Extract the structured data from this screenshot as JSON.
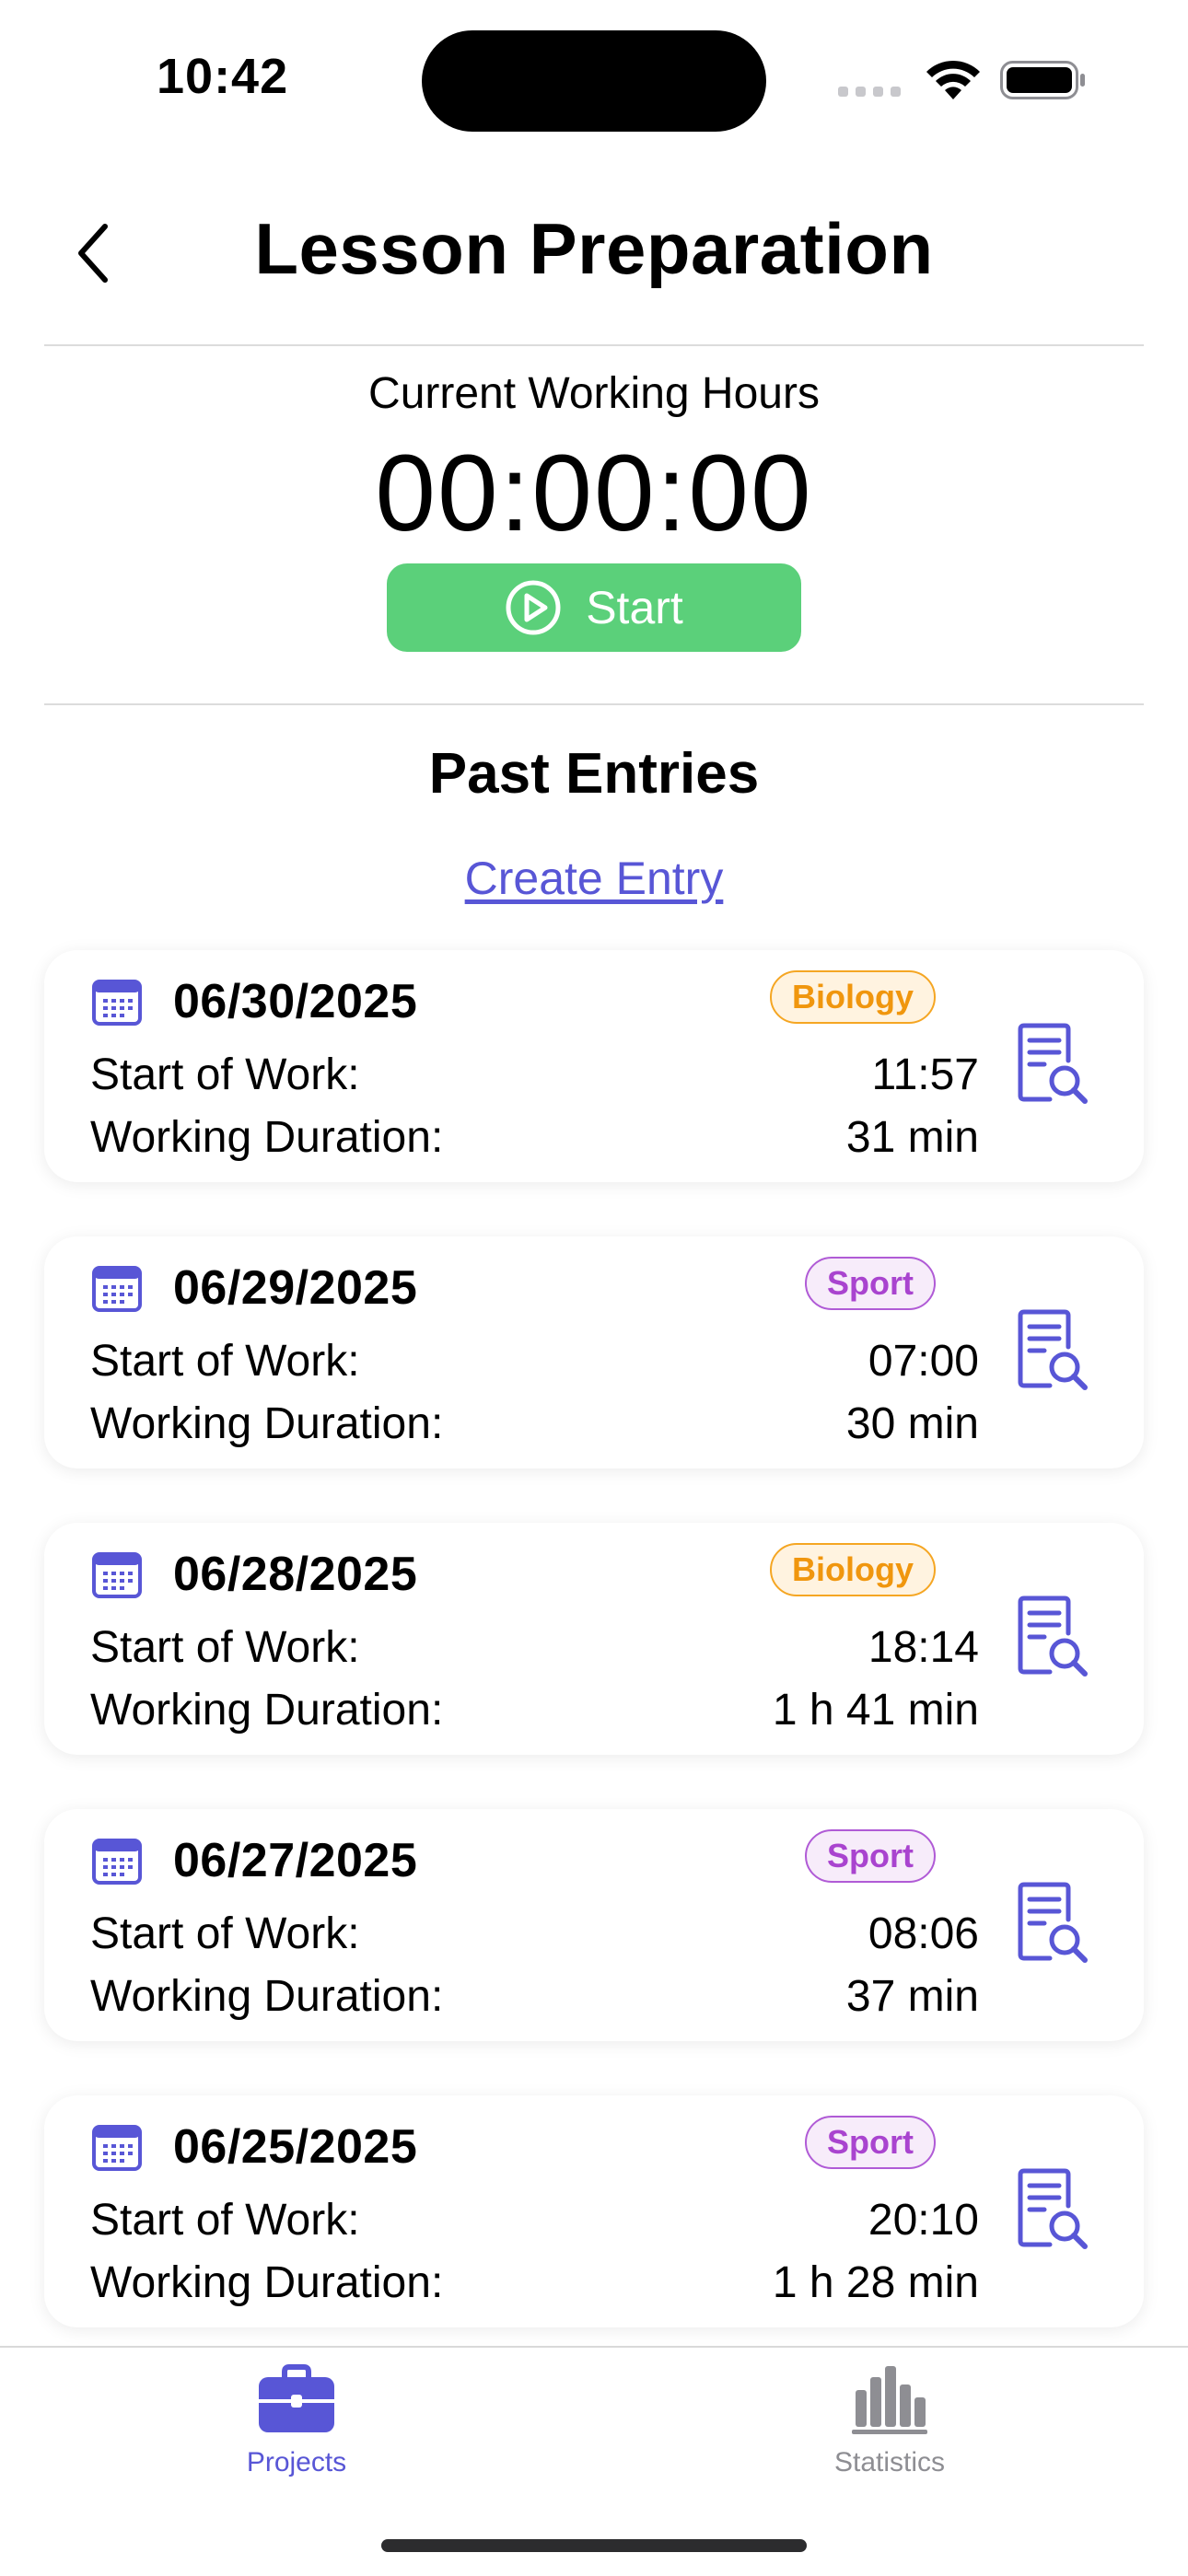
{
  "status_bar": {
    "time": "10:42"
  },
  "header": {
    "title": "Lesson Preparation"
  },
  "timer": {
    "label": "Current Working Hours",
    "value": "00:00:00",
    "start_label": "Start"
  },
  "past_entries": {
    "title": "Past Entries",
    "create_label": "Create Entry",
    "start_label": "Start of Work:",
    "duration_label": "Working Duration:",
    "items": [
      {
        "date": "06/30/2025",
        "tag": "Biology",
        "start": "11:57",
        "duration": "31 min"
      },
      {
        "date": "06/29/2025",
        "tag": "Sport",
        "start": "07:00",
        "duration": "30 min"
      },
      {
        "date": "06/28/2025",
        "tag": "Biology",
        "start": "18:14",
        "duration": "1 h 41 min"
      },
      {
        "date": "06/27/2025",
        "tag": "Sport",
        "start": "08:06",
        "duration": "37 min"
      },
      {
        "date": "06/25/2025",
        "tag": "Sport",
        "start": "20:10",
        "duration": "1 h 28 min"
      }
    ]
  },
  "tab_bar": {
    "tabs": [
      {
        "label": "Projects",
        "icon": "briefcase-icon",
        "active": true
      },
      {
        "label": "Statistics",
        "icon": "bar-chart-icon",
        "active": false
      }
    ]
  },
  "colors": {
    "accent": "#5856d6",
    "start_button": "#5bd07a",
    "biology_tag": "#f0960e",
    "sport_tag": "#a944cf",
    "inactive_tab": "#8e8e93"
  }
}
